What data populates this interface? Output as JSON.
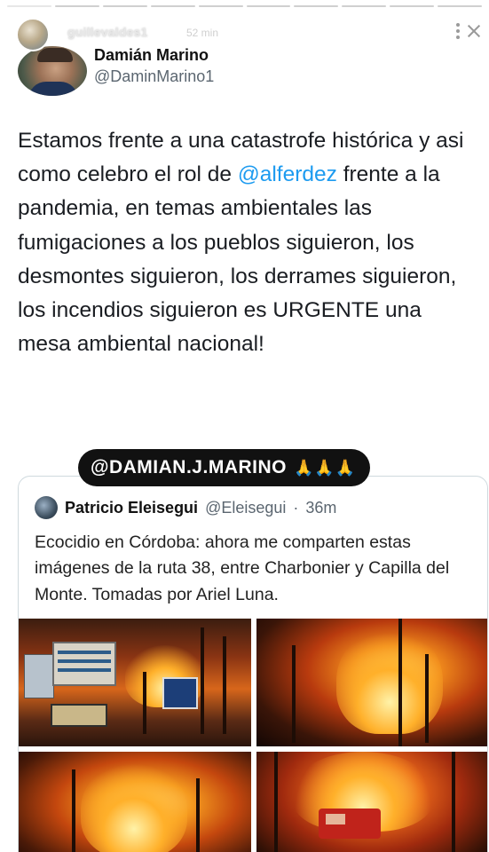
{
  "story": {
    "username": "guillevaldes1",
    "time": "52 min",
    "segments": 10,
    "current_segment": 0
  },
  "tweet": {
    "author_name": "Damián Marino",
    "author_handle": "@DaminMarino1",
    "text_before": "Estamos frente a una catastrofe histórica y asi como celebro el rol de ",
    "mention": "@alferdez",
    "text_after": " frente a la pandemia, en temas ambientales las fumigaciones a los pueblos siguieron, los desmontes siguieron, los derrames siguieron, los incendios siguieron es URGENTE una mesa ambiental nacional!"
  },
  "sticker": {
    "text": "@DAMIAN.J.MARINO",
    "emoji": "🙏🙏🙏"
  },
  "quoted_tweet": {
    "author_name": "Patricio Eleisegui",
    "author_handle": "@Eleisegui",
    "separator": "·",
    "time": "36m",
    "text": "Ecocidio en Córdoba: ahora me comparten estas imágenes de la ruta 38, entre Charbonier y Capilla del Monte. Tomadas por Ariel Luna."
  },
  "colors": {
    "link": "#1d9bf0",
    "sticker_bg": "#111111",
    "text": "#1a1d22",
    "secondary_text": "#5b6670"
  },
  "icons": {
    "more": "more-vertical-icon",
    "close": "close-icon"
  }
}
